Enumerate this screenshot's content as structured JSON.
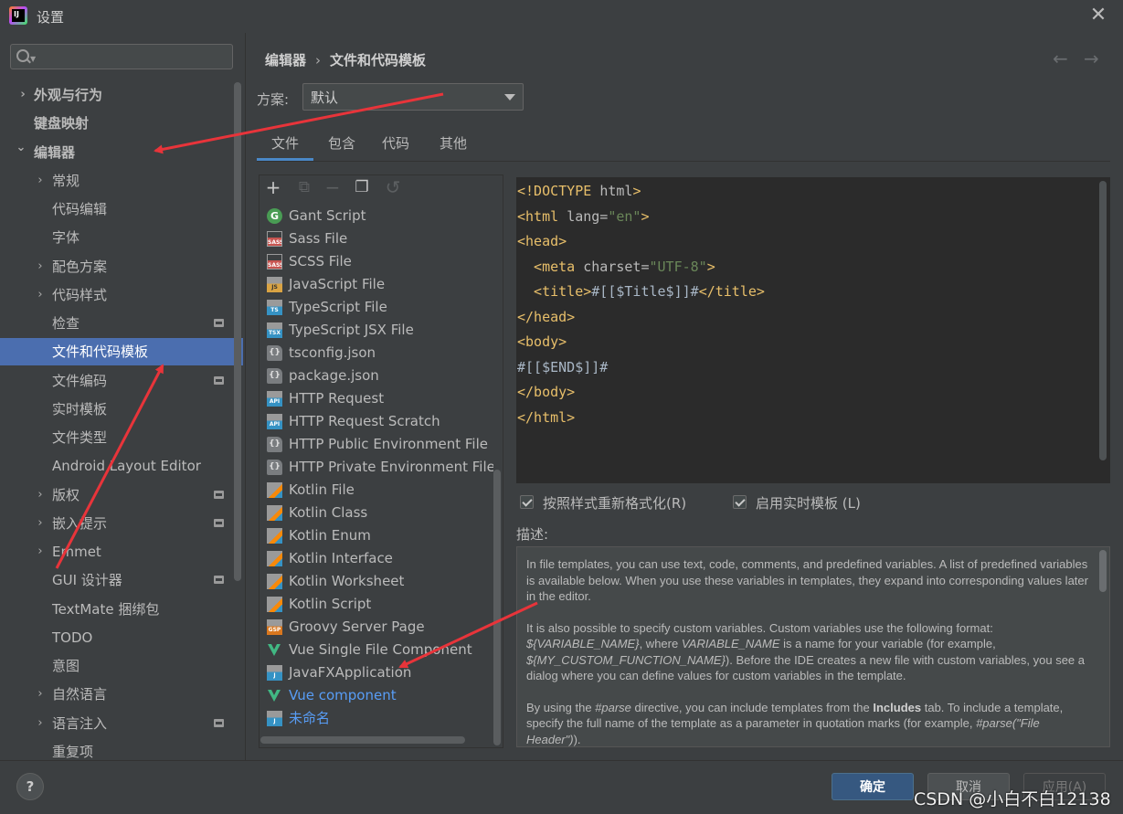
{
  "window": {
    "title": "设置",
    "close": "✕",
    "app_icon_text": "IJ"
  },
  "search": {
    "placeholder": "",
    "value": ""
  },
  "sidebar": {
    "items": [
      {
        "label": "外观与行为",
        "chevron": "›"
      },
      {
        "label": "键盘映射"
      },
      {
        "label": "编辑器",
        "chevron": "⌄"
      },
      {
        "label": "常规",
        "chevron": "›"
      },
      {
        "label": "代码编辑"
      },
      {
        "label": "字体"
      },
      {
        "label": "配色方案",
        "chevron": "›"
      },
      {
        "label": "代码样式",
        "chevron": "›"
      },
      {
        "label": "检查"
      },
      {
        "label": "文件和代码模板"
      },
      {
        "label": "文件编码"
      },
      {
        "label": "实时模板"
      },
      {
        "label": "文件类型"
      },
      {
        "label": "Android Layout Editor"
      },
      {
        "label": "版权",
        "chevron": "›"
      },
      {
        "label": "嵌入提示",
        "chevron": "›"
      },
      {
        "label": "Emmet",
        "chevron": "›"
      },
      {
        "label": "GUI 设计器"
      },
      {
        "label": "TextMate 捆绑包"
      },
      {
        "label": "TODO"
      },
      {
        "label": "意图"
      },
      {
        "label": "自然语言",
        "chevron": "›"
      },
      {
        "label": "语言注入",
        "chevron": "›"
      },
      {
        "label": "重复项"
      }
    ],
    "selected": "文件和代码模板"
  },
  "breadcrumb": {
    "parent": "编辑器",
    "separator": "›",
    "current": "文件和代码模板"
  },
  "nav": {
    "back": "←",
    "forward": "→"
  },
  "scheme": {
    "label": "方案:",
    "value": "默认"
  },
  "tabs": [
    {
      "label": "文件",
      "active": true
    },
    {
      "label": "包含"
    },
    {
      "label": "代码"
    },
    {
      "label": "其他"
    }
  ],
  "toolbar": {
    "add": "+",
    "copy_disabled": "⧉",
    "remove": "−",
    "duplicate": "❐",
    "reset": "↺"
  },
  "templates": [
    {
      "label": "Gant Script",
      "icon": "gant-icon",
      "icon_text": "G"
    },
    {
      "label": "Sass File",
      "icon": "sass-icon",
      "icon_text": "SASS"
    },
    {
      "label": "SCSS File",
      "icon": "scss-icon",
      "icon_text": "SASS"
    },
    {
      "label": "JavaScript File",
      "icon": "js-icon",
      "icon_text": "JS"
    },
    {
      "label": "TypeScript File",
      "icon": "ts-icon",
      "icon_text": "TS"
    },
    {
      "label": "TypeScript JSX File",
      "icon": "tsx-icon",
      "icon_text": "TSX"
    },
    {
      "label": "tsconfig.json",
      "icon": "json-icon",
      "icon_text": "{}"
    },
    {
      "label": "package.json",
      "icon": "json-icon",
      "icon_text": "{}"
    },
    {
      "label": "HTTP Request",
      "icon": "api-icon",
      "icon_text": "API"
    },
    {
      "label": "HTTP Request Scratch",
      "icon": "api-icon",
      "icon_text": "API"
    },
    {
      "label": "HTTP Public Environment File",
      "icon": "json-icon",
      "icon_text": "{}"
    },
    {
      "label": "HTTP Private Environment File",
      "icon": "json-icon",
      "icon_text": "{}"
    },
    {
      "label": "Kotlin File",
      "icon": "kotlin-icon",
      "icon_text": ""
    },
    {
      "label": "Kotlin Class",
      "icon": "kotlin-icon",
      "icon_text": ""
    },
    {
      "label": "Kotlin Enum",
      "icon": "kotlin-icon",
      "icon_text": ""
    },
    {
      "label": "Kotlin Interface",
      "icon": "kotlin-icon",
      "icon_text": ""
    },
    {
      "label": "Kotlin Worksheet",
      "icon": "kotlin-icon",
      "icon_text": ""
    },
    {
      "label": "Kotlin Script",
      "icon": "kotlin-icon",
      "icon_text": ""
    },
    {
      "label": "Groovy Server Page",
      "icon": "gsp-icon",
      "icon_text": "GSP"
    },
    {
      "label": "Vue Single File Component",
      "icon": "vue-icon",
      "icon_text": ""
    },
    {
      "label": "JavaFXApplication",
      "icon": "java-icon",
      "icon_text": "J"
    },
    {
      "label": "Vue component",
      "icon": "vue-icon",
      "icon_text": "",
      "color": "#589df6"
    },
    {
      "label": "未命名",
      "icon": "java-icon",
      "icon_text": "J",
      "color": "#589df6"
    }
  ],
  "editor": {
    "lines": [
      [
        {
          "t": "<!DOCTYPE ",
          "c": "tag"
        },
        {
          "t": "html",
          "c": "attr"
        },
        {
          "t": ">",
          "c": "tag"
        }
      ],
      [
        {
          "t": "<html ",
          "c": "tag"
        },
        {
          "t": "lang=",
          "c": "attr"
        },
        {
          "t": "\"en\"",
          "c": "str"
        },
        {
          "t": ">",
          "c": "tag"
        }
      ],
      [
        {
          "t": "<head>",
          "c": "tag"
        }
      ],
      [
        {
          "t": "  <meta ",
          "c": "tag"
        },
        {
          "t": "charset=",
          "c": "attr"
        },
        {
          "t": "\"UTF-8\"",
          "c": "str"
        },
        {
          "t": ">",
          "c": "tag"
        }
      ],
      [
        {
          "t": "  <title>",
          "c": "tag"
        },
        {
          "t": "#[[$Title$]]#",
          "c": "txt"
        },
        {
          "t": "</title>",
          "c": "tag"
        }
      ],
      [
        {
          "t": "</head>",
          "c": "tag"
        }
      ],
      [
        {
          "t": "<body>",
          "c": "tag"
        }
      ],
      [
        {
          "t": "#[[$END$]]#",
          "c": "txt"
        }
      ],
      [
        {
          "t": "</body>",
          "c": "tag"
        }
      ],
      [
        {
          "t": "</html>",
          "c": "tag"
        }
      ]
    ]
  },
  "options": {
    "reformat": {
      "label": "按照样式重新格式化(R)",
      "checked": true
    },
    "live_templates": {
      "label": "启用实时模板 (L)",
      "checked": true
    }
  },
  "description": {
    "title": "描述:",
    "p1": "In file templates, you can use text, code, comments, and predefined variables. A list of predefined variables is available below. When you use these variables in templates, they expand into corresponding values later in the editor.",
    "p2_a": "It is also possible to specify custom variables. Custom variables use the following format: ",
    "p2_var": "${VARIABLE_NAME}",
    "p2_b": ", where ",
    "p2_var2": "VARIABLE_NAME",
    "p2_c": " is a name for your variable (for example, ",
    "p2_var3": "${MY_CUSTOM_FUNCTION_NAME}",
    "p2_d": "). Before the IDE creates a new file with custom variables, you see a dialog where you can define values for custom variables in the template.",
    "p3_a": "By using the ",
    "p3_parse": "#parse",
    "p3_b": " directive, you can include templates from the ",
    "p3_inc": "Includes",
    "p3_c": " tab. To include a template, specify the full name of the template as a parameter in quotation marks (for example, ",
    "p3_ex": "#parse(\"File Header\")",
    "p3_d": ")."
  },
  "footer": {
    "help": "?",
    "ok": "确定",
    "cancel": "取消",
    "apply": "应用(A)"
  },
  "watermark": "CSDN @小白不白12138",
  "colors": {
    "accent": "#4b6eaf",
    "annotation_arrow": "#e8343a",
    "primary_button": "#365880"
  }
}
